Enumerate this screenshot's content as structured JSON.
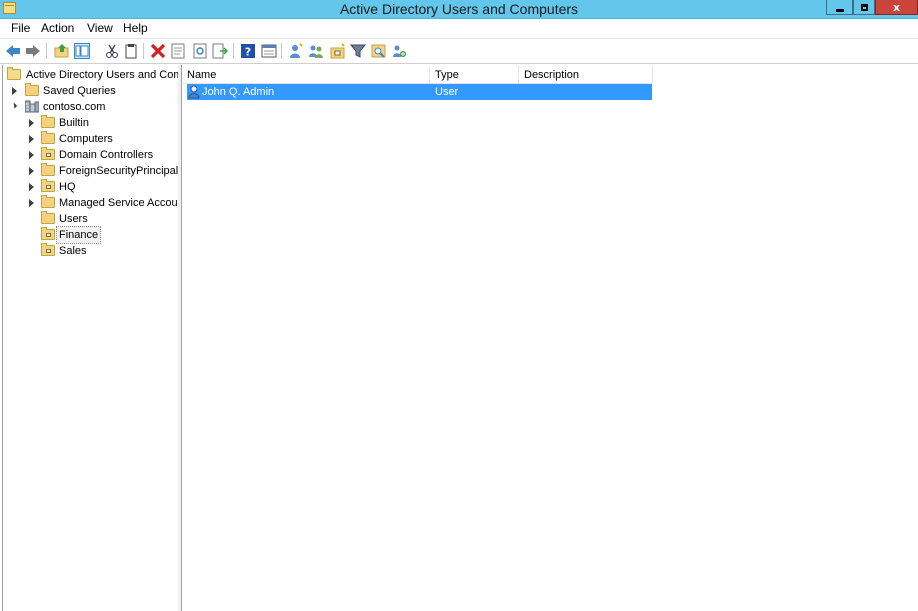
{
  "window": {
    "title": "Active Directory Users and Computers",
    "close_glyph": "x"
  },
  "menu": [
    "File",
    "Action",
    "View",
    "Help"
  ],
  "toolbar_icons": [
    "back-icon",
    "forward-icon",
    "up-icon",
    "show-hide-tree-icon",
    "cut-icon",
    "copy-icon",
    "delete-icon",
    "properties-icon",
    "refresh-icon",
    "export-list-icon",
    "help-icon",
    "console-view-icon",
    "new-user-icon",
    "new-group-icon",
    "new-ou-icon",
    "filter-icon",
    "find-icon",
    "add-to-group-icon"
  ],
  "tree": {
    "root": "Active Directory Users and Com",
    "saved_queries": "Saved Queries",
    "domain": "contoso.com",
    "children": [
      {
        "label": "Builtin",
        "expandable": true,
        "ou": false
      },
      {
        "label": "Computers",
        "expandable": true,
        "ou": false
      },
      {
        "label": "Domain Controllers",
        "expandable": true,
        "ou": true
      },
      {
        "label": "ForeignSecurityPrincipals",
        "expandable": true,
        "ou": false
      },
      {
        "label": "HQ",
        "expandable": true,
        "ou": true
      },
      {
        "label": "Managed Service Accour",
        "expandable": true,
        "ou": false
      },
      {
        "label": "Users",
        "expandable": false,
        "ou": false
      },
      {
        "label": "Finance",
        "expandable": false,
        "ou": true,
        "selected": true
      },
      {
        "label": "Sales",
        "expandable": false,
        "ou": true
      }
    ]
  },
  "list": {
    "columns": [
      "Name",
      "Type",
      "Description"
    ],
    "rows": [
      {
        "name": "John Q. Admin",
        "type": "User",
        "description": ""
      }
    ]
  },
  "colors": {
    "titlebar": "#63c7ec",
    "selection": "#3399ff",
    "close_button": "#c9443a"
  }
}
